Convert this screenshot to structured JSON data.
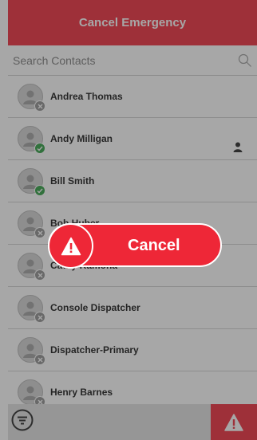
{
  "header": {
    "title": "Cancel Emergency"
  },
  "search": {
    "placeholder": "Search Contacts"
  },
  "contacts": [
    {
      "name": "Andrea Thomas",
      "status": "offline"
    },
    {
      "name": "Andy Milligan",
      "status": "online"
    },
    {
      "name": "Bill Smith",
      "status": "online"
    },
    {
      "name": "Bob Huber",
      "status": "offline"
    },
    {
      "name": "Cathy Ramona",
      "status": "offline"
    },
    {
      "name": "Console Dispatcher",
      "status": "offline"
    },
    {
      "name": "Dispatcher-Primary",
      "status": "offline"
    },
    {
      "name": "Henry Barnes",
      "status": "offline"
    }
  ],
  "cancel_overlay": {
    "label": "Cancel"
  },
  "colors": {
    "accent": "#ee2737",
    "online": "#2a9d3e",
    "offline": "#8e8e8e"
  }
}
